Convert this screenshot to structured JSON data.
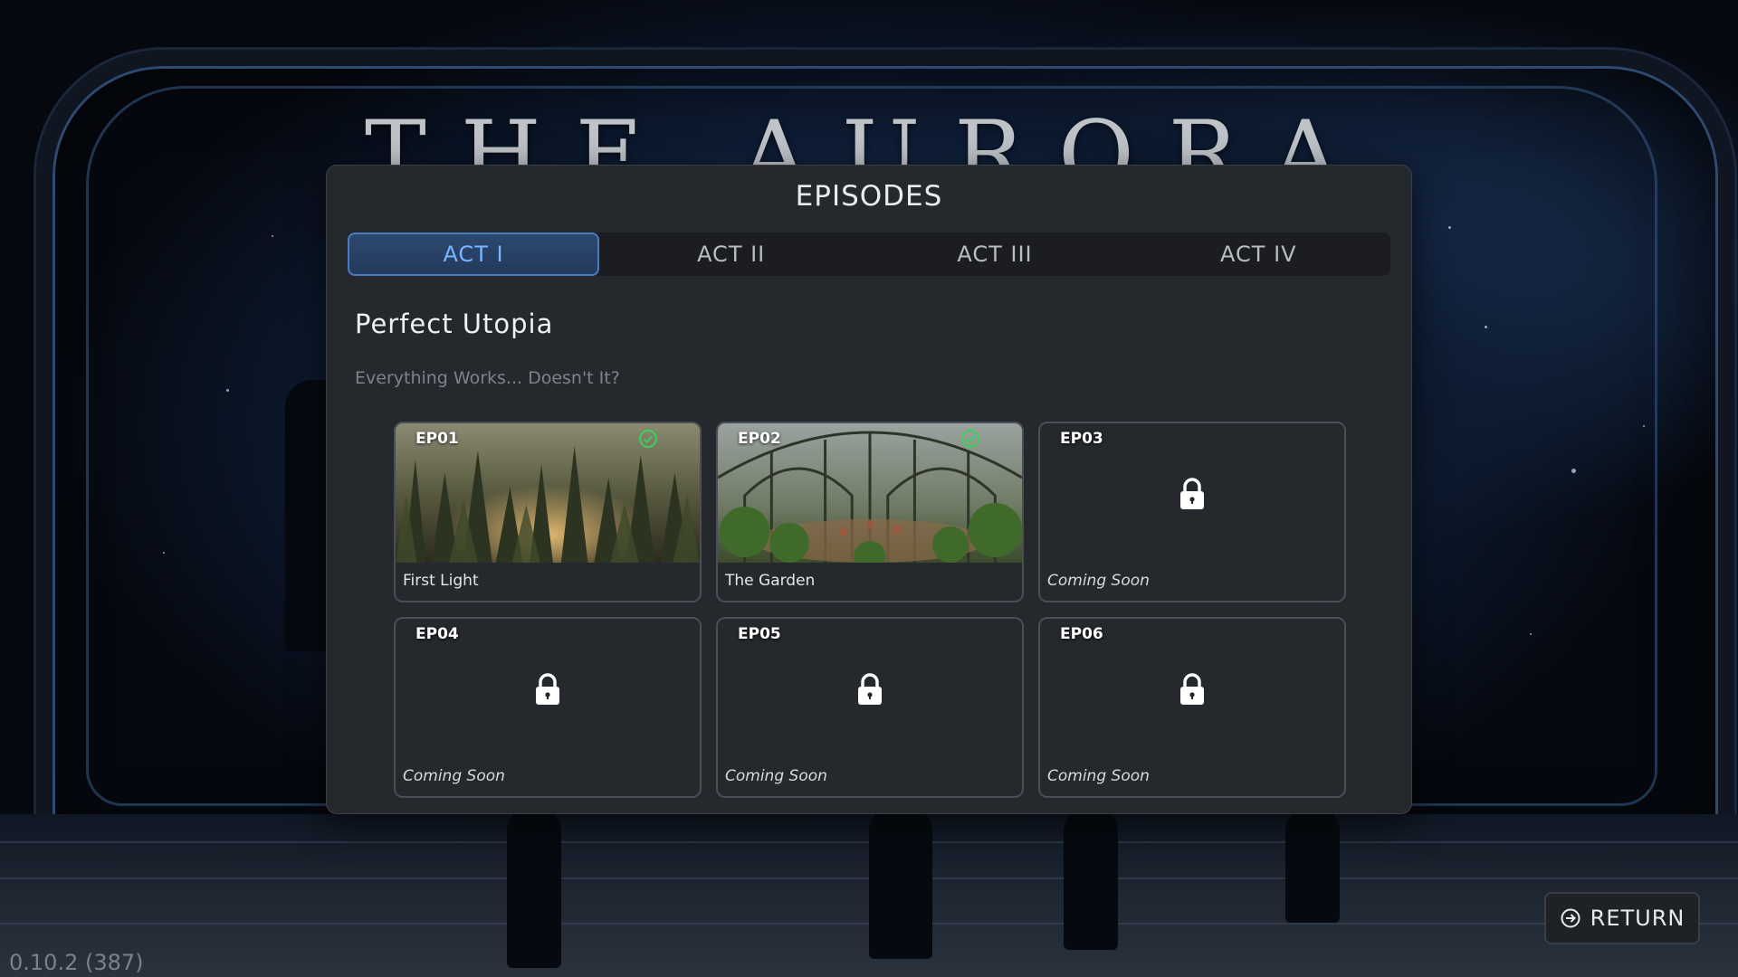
{
  "game": {
    "title": "THE AURORA CHRONICLES"
  },
  "panel": {
    "title": "EPISODES",
    "tabs": [
      {
        "label": "ACT I",
        "active": true
      },
      {
        "label": "ACT II",
        "active": false
      },
      {
        "label": "ACT III",
        "active": false
      },
      {
        "label": "ACT IV",
        "active": false
      }
    ],
    "act_title": "Perfect Utopia",
    "act_subtitle": "Everything Works... Doesn't It?",
    "episodes": [
      {
        "code": "EP01",
        "name": "First Light",
        "completed": true,
        "locked": false
      },
      {
        "code": "EP02",
        "name": "The Garden",
        "completed": true,
        "locked": false
      },
      {
        "code": "EP03",
        "name": "Coming Soon",
        "completed": false,
        "locked": true
      },
      {
        "code": "EP04",
        "name": "Coming Soon",
        "completed": false,
        "locked": true
      },
      {
        "code": "EP05",
        "name": "Coming Soon",
        "completed": false,
        "locked": true
      },
      {
        "code": "EP06",
        "name": "Coming Soon",
        "completed": false,
        "locked": true
      }
    ]
  },
  "footer": {
    "version": "0.10.2 (387)",
    "return_label": "RETURN"
  },
  "colors": {
    "accent": "#4a7ac0",
    "active_tab_text": "#7ab6ff",
    "completed_check": "#3ecf5a",
    "panel_bg": "#25282d"
  }
}
